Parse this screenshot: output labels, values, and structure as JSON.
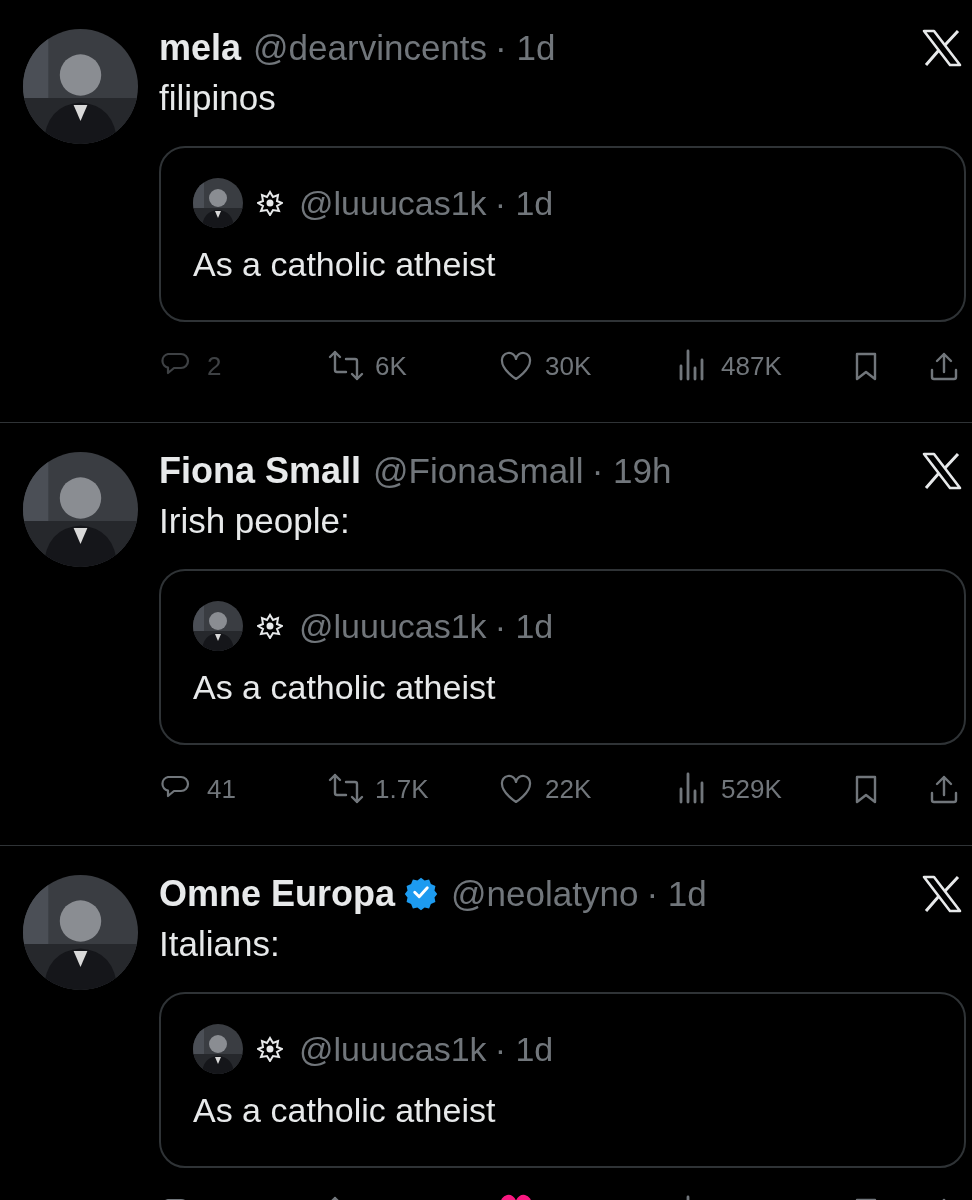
{
  "posts": [
    {
      "name": "mela",
      "verified": false,
      "handle": "@dearvincents",
      "time": "· 1d",
      "text": "filipinos",
      "quote": {
        "handle": "@luuucas1k",
        "time": "· 1d",
        "text": "As a catholic atheist"
      },
      "liked": false,
      "stats": [
        {
          "kind": "reply",
          "count": "2",
          "disabled": true
        },
        {
          "kind": "repost",
          "count": "6K",
          "disabled": false
        },
        {
          "kind": "like",
          "count": "30K",
          "disabled": false
        },
        {
          "kind": "views",
          "count": "487K",
          "disabled": false
        },
        {
          "kind": "bookmark",
          "disabled": false
        },
        {
          "kind": "share",
          "disabled": false
        }
      ]
    },
    {
      "name": "Fiona Small",
      "verified": false,
      "handle": "@FionaSmall",
      "time": "· 19h",
      "text": "Irish people:",
      "quote": {
        "handle": "@luuucas1k",
        "time": "· 1d",
        "text": "As a catholic atheist"
      },
      "liked": false,
      "stats": [
        {
          "kind": "reply",
          "count": "41",
          "disabled": false
        },
        {
          "kind": "repost",
          "count": "1.7K",
          "disabled": false
        },
        {
          "kind": "like",
          "count": "22K",
          "disabled": false
        },
        {
          "kind": "views",
          "count": "529K",
          "disabled": false
        },
        {
          "kind": "bookmark",
          "disabled": false
        },
        {
          "kind": "share",
          "disabled": false
        }
      ]
    },
    {
      "name": "Omne Europa",
      "verified": true,
      "handle": "@neolatyno",
      "time": "· 1d",
      "text": "Italians:",
      "quote": {
        "handle": "@luuucas1k",
        "time": "· 1d",
        "text": "As a catholic atheist"
      },
      "liked": true,
      "stats": [
        {
          "kind": "reply",
          "disabled": false
        },
        {
          "kind": "repost",
          "disabled": false
        },
        {
          "kind": "like",
          "disabled": false
        },
        {
          "kind": "views",
          "disabled": false
        },
        {
          "kind": "bookmark",
          "disabled": false
        },
        {
          "kind": "share",
          "disabled": false
        }
      ]
    }
  ]
}
